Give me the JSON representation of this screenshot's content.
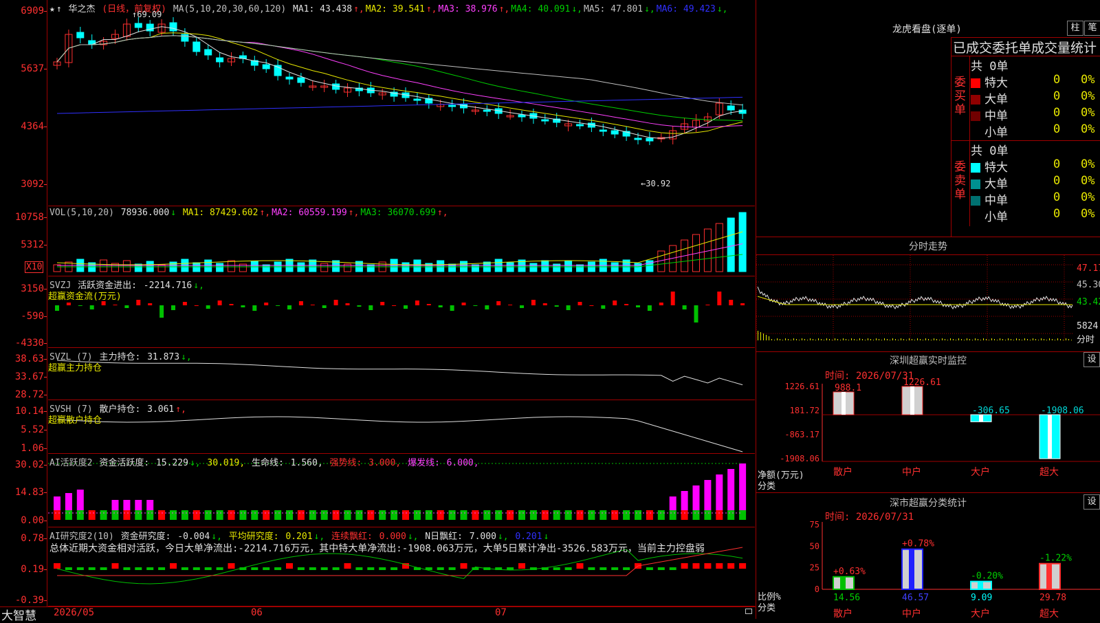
{
  "stock": {
    "name": "华之杰",
    "mode": "(日线，前复权)",
    "ma_label": "MA(5,10,20,30,60,120)",
    "ma": [
      {
        "label": "MA1:",
        "value": "43.438",
        "arrow": "↑",
        "color": "#e0e0e0"
      },
      {
        "label": "MA2:",
        "value": "39.541",
        "arrow": "↑",
        "color": "#e8e800"
      },
      {
        "label": "MA3:",
        "value": "38.976",
        "arrow": "↑",
        "color": "#ff40ff"
      },
      {
        "label": "MA4:",
        "value": "40.091",
        "arrow": "↓",
        "color": "#00d000"
      },
      {
        "label": "MA5:",
        "value": "47.801",
        "arrow": "↓",
        "color": "#c0c0c0"
      },
      {
        "label": "MA6:",
        "value": "49.423",
        "arrow": "↓",
        "color": "#3030ff"
      }
    ],
    "high_mark": "69.09",
    "low_mark": "30.92"
  },
  "axes": {
    "price": [
      "6909",
      "5637",
      "4364",
      "3092"
    ],
    "vol": [
      "10758",
      "5312"
    ],
    "vol_unit": "X10",
    "svzj": [
      "3150",
      "-590",
      "-4330"
    ],
    "svzl": [
      "38.63",
      "33.67",
      "28.72"
    ],
    "svsh": [
      "10.14",
      "5.52",
      "1.06"
    ],
    "ai_active": [
      "30.02",
      "14.83",
      "0.00"
    ],
    "ai_research": [
      "0.78",
      "0.19",
      "-0.39"
    ]
  },
  "panels": {
    "vol": {
      "label": "VOL(5,10,20)",
      "value": "78936.000",
      "arrow": "↓",
      "ma": [
        {
          "label": "MA1:",
          "value": "87429.602",
          "arrow": "↑",
          "color": "#e8e800"
        },
        {
          "label": "MA2:",
          "value": "60559.199",
          "arrow": "↑",
          "color": "#ff40ff"
        },
        {
          "label": "MA3:",
          "value": "36070.699",
          "arrow": "↑",
          "color": "#00d000"
        }
      ]
    },
    "svzj": {
      "label": "SVZJ",
      "title": "活跃资金进出:",
      "value": "-2214.716",
      "arrow": "↓,",
      "sub": "超赢资金流(万元)"
    },
    "svzl": {
      "label": "SVZL (7)",
      "title": "主力持仓:",
      "value": "31.873",
      "arrow": "↓,",
      "sub": "超赢主力持仓"
    },
    "svsh": {
      "label": "SVSH (7)",
      "title": "散户持仓:",
      "value": "3.061",
      "arrow": "↑,",
      "sub": "超赢散户持仓"
    },
    "ai_active": {
      "label": "AI活跃度2",
      "title": "资金活跃度:",
      "value": "15.229",
      "arrow": "↓,",
      "v2": "30.019,",
      "life_label": "生命线:",
      "life": "1.560,",
      "strong_label": "强势线:",
      "strong": "3.000,",
      "burst_label": "爆发线:",
      "burst": "6.000,"
    },
    "ai_research": {
      "label": "AI研究度2(10)",
      "title": "资金研究度:",
      "value": "-0.004",
      "arrow": "↓,",
      "avg_label": "平均研究度:",
      "avg": "0.201",
      "avg_arrow": "↓,",
      "red_label": "连续飘红:",
      "red": "0.000",
      "red_arrow": "↓,",
      "nred_label": "N日飘红:",
      "nred": "7.000",
      "nred_arrow": "↓,",
      "last": "0.201",
      "last_arrow": "↓",
      "summary": "总体近期大资金相对活跃，今日大单净流出:-2214.716万元，其中特大单净流出:-1908.063万元，大单5日累计净出-3526.583万元，当前主力控盘弱"
    }
  },
  "bottom": {
    "logo": "大智慧",
    "dates": [
      "2026/05",
      "06",
      "07"
    ]
  },
  "longhu": {
    "title": "龙虎看盘(逐单)",
    "btn_bar": "柱",
    "btn_pen": "笔",
    "header": "已成交委托单成交量统计",
    "buy_label": "委买单",
    "sell_label": "委卖单",
    "buy_total": "共 0单",
    "sell_total": "共 0单",
    "buy_rows": [
      {
        "name": "特大",
        "count": "0",
        "pct": "0%",
        "color": "#ff0000"
      },
      {
        "name": "大单",
        "count": "0",
        "pct": "0%",
        "color": "#900000"
      },
      {
        "name": "中单",
        "count": "0",
        "pct": "0%",
        "color": "#700000"
      },
      {
        "name": "小单",
        "count": "0",
        "pct": "0%",
        "color": "#000000"
      }
    ],
    "sell_rows": [
      {
        "name": "特大",
        "count": "0",
        "pct": "0%",
        "color": "#00ffff"
      },
      {
        "name": "大单",
        "count": "0",
        "pct": "0%",
        "color": "#009090"
      },
      {
        "name": "中单",
        "count": "0",
        "pct": "0%",
        "color": "#007070"
      },
      {
        "name": "小单",
        "count": "0",
        "pct": "0%",
        "color": "#000000"
      }
    ]
  },
  "intraday": {
    "title": "分时走势",
    "labels": [
      "47.17",
      "45.30",
      "43.42",
      "5824",
      "分时"
    ]
  },
  "sz_monitor": {
    "title": "深圳超赢实时监控",
    "btn": "设",
    "time_label": "时间:",
    "time": "2026/07/31",
    "y_labels": [
      "1226.61",
      "181.72",
      "-863.17",
      "-1908.06"
    ],
    "y_caption": "净额(万元)",
    "x_caption": "分类",
    "categories": [
      "散户",
      "中户",
      "大户",
      "超大"
    ],
    "values": [
      988.1,
      1226.61,
      -306.65,
      -1908.06
    ],
    "value_labels": [
      "988.1",
      "1226.61",
      "-306.65",
      "-1908.06"
    ]
  },
  "sz_class": {
    "title": "深市超赢分类统计",
    "btn": "设",
    "time_label": "时间:",
    "time": "2026/07/31",
    "y_labels": [
      "75",
      "50",
      "25",
      "0"
    ],
    "y_caption": "比例%",
    "x_caption": "分类",
    "categories": [
      "散户",
      "中户",
      "大户",
      "超大"
    ],
    "values": [
      14.56,
      46.57,
      9.09,
      29.78
    ],
    "changes": [
      "+0.63%",
      "+0.78%",
      "-0.20%",
      "-1.22%"
    ]
  },
  "chart_data": {
    "type": "bar",
    "title": "深圳超赢实时监控",
    "categories": [
      "散户",
      "中户",
      "大户",
      "超大"
    ],
    "series": [
      {
        "name": "净额(万元)",
        "values": [
          988.1,
          1226.61,
          -306.65,
          -1908.06
        ]
      }
    ]
  }
}
